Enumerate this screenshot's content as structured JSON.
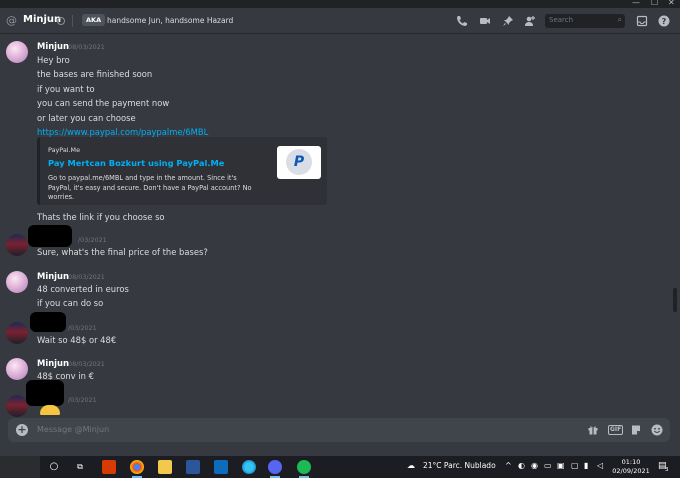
{
  "window": {
    "controls": [
      "—",
      "☐",
      "✕"
    ]
  },
  "header": {
    "channel_name": "Minjun",
    "aka_label": "AKA",
    "aka_names": "handsome Jun, handsome Hazard",
    "search_placeholder": "Search",
    "icons": [
      "call-icon",
      "video-icon",
      "pin-icon",
      "add-member-icon",
      "search-icon",
      "inbox-icon",
      "help-icon"
    ]
  },
  "messages": [
    {
      "author": "Minjun",
      "timestamp": "08/03/2021",
      "lines": [
        "Hey bro",
        "the bases are finished soon",
        "if you want to",
        "you can send the payment now",
        "or later you can choose"
      ],
      "link": "https://www.paypal.com/paypalme/6MBL"
    },
    {
      "embed": {
        "provider": "PayPal.Me",
        "title": "Pay Mertcan Bozkurt using PayPal.Me",
        "description": "Go to paypal.me/6MBL and type in the amount. Since it's PayPal, it's easy and secure. Don't have a PayPal account? No worries."
      }
    },
    {
      "continuation": "Thats the link if you choose so"
    },
    {
      "author": "",
      "timestamp": "/03/2021",
      "lines": [
        "Sure, what's the final price of the bases?"
      ]
    },
    {
      "author": "Minjun",
      "timestamp": "08/03/2021",
      "lines": [
        "48 converted in euros",
        "if you can do so"
      ]
    },
    {
      "author": "",
      "timestamp": "/03/2021",
      "lines": [
        "Wait so 48$ or 48€"
      ]
    },
    {
      "author": "Minjun",
      "timestamp": "08/03/2021",
      "lines": [
        "48$ conv in €"
      ]
    },
    {
      "author": "",
      "timestamp": "/03/2021",
      "lines": []
    }
  ],
  "composer": {
    "placeholder": "Message @Minjun",
    "gif_label": "GIF"
  },
  "taskbar": {
    "weather": "21°C  Parc. Nublado",
    "time": "01:10",
    "date": "02/09/2021",
    "notification_count": "3"
  }
}
